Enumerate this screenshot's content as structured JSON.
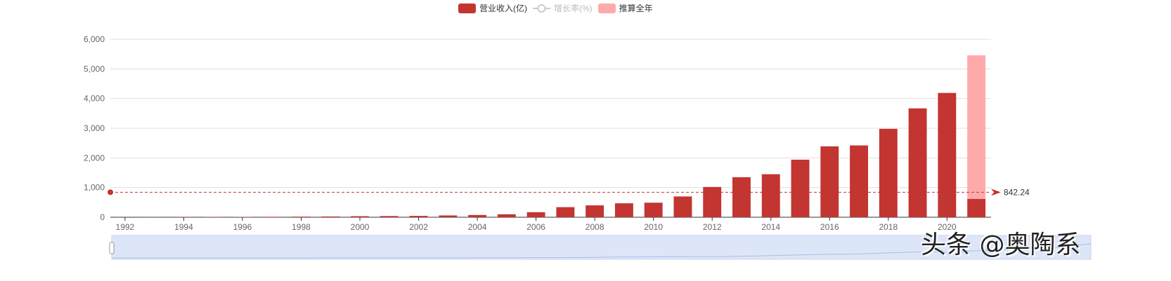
{
  "chart_data": {
    "type": "bar",
    "title": "",
    "legend": [
      {
        "name": "营业收入(亿)",
        "color": "#c23531",
        "active": true
      },
      {
        "name": "增长率(%)",
        "color": "#cccccc",
        "active": false
      },
      {
        "name": "推算全年",
        "color": "#ffaaaa",
        "active": true
      }
    ],
    "categories": [
      "1992",
      "1993",
      "1994",
      "1995",
      "1996",
      "1997",
      "1998",
      "1999",
      "2000",
      "2001",
      "2002",
      "2003",
      "2004",
      "2005",
      "2006",
      "2007",
      "2008",
      "2009",
      "2010",
      "2011",
      "2012",
      "2013",
      "2014",
      "2015",
      "2016",
      "2017",
      "2018",
      "2019",
      "2020",
      "2021"
    ],
    "x_tick_labels": [
      "1992",
      "1994",
      "1996",
      "1998",
      "2000",
      "2002",
      "2004",
      "2006",
      "2008",
      "2010",
      "2012",
      "2014",
      "2016",
      "2018",
      "2020"
    ],
    "series": [
      {
        "name": "营业收入(亿)",
        "values": [
          2,
          4,
          6,
          8,
          10,
          15,
          20,
          25,
          35,
          40,
          45,
          60,
          75,
          100,
          170,
          340,
          400,
          470,
          490,
          700,
          1020,
          1350,
          1450,
          1940,
          2390,
          2420,
          2980,
          3670,
          4190,
          620
        ]
      },
      {
        "name": "推算全年",
        "stacked": true,
        "values": [
          0,
          0,
          0,
          0,
          0,
          0,
          0,
          0,
          0,
          0,
          0,
          0,
          0,
          0,
          0,
          0,
          0,
          0,
          0,
          0,
          0,
          0,
          0,
          0,
          0,
          0,
          0,
          0,
          0,
          4840
        ]
      }
    ],
    "markline": {
      "type": "average",
      "value": 842.24,
      "label": "842.24"
    },
    "ylim": [
      0,
      6000
    ],
    "y_ticks": [
      "0",
      "1,000",
      "2,000",
      "3,000",
      "4,000",
      "5,000",
      "6,000"
    ],
    "grid": true,
    "legend_position": "top-center"
  },
  "watermark": "头条 @奥陶系"
}
